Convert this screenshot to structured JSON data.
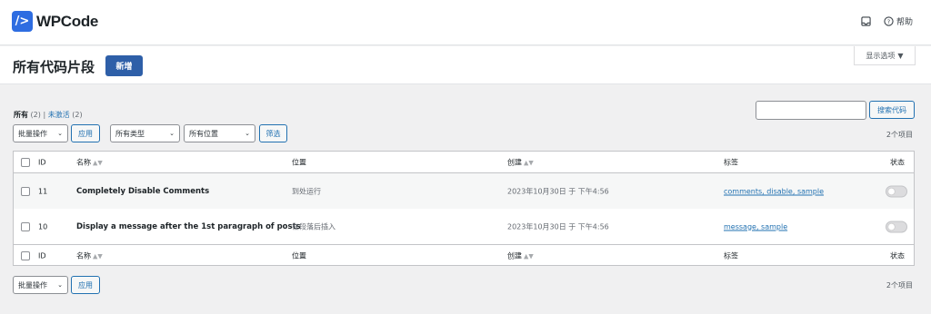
{
  "app": {
    "logo_glyph": "/>",
    "logo_text": "WPCode",
    "help_label": "帮助"
  },
  "header": {
    "title": "所有代码片段",
    "add_new": "新增",
    "screen_options": "显示选项"
  },
  "filters": {
    "all_label": "所有",
    "all_count": "(2)",
    "separator": "|",
    "inactive_label": "未激活",
    "inactive_count": "(2)"
  },
  "search": {
    "button": "搜索代码",
    "value": ""
  },
  "bulk": {
    "select_label": "批量操作",
    "apply": "应用"
  },
  "type_filter": {
    "selected": "所有类型"
  },
  "location_filter": {
    "selected": "所有位置"
  },
  "filter_button": "筛选",
  "items_count": "2个项目",
  "columns": {
    "id": "ID",
    "name": "名称",
    "location": "位置",
    "created": "创建",
    "tags": "标签",
    "status": "状态"
  },
  "rows": [
    {
      "id": "11",
      "name": "Completely Disable Comments",
      "location": "到处运行",
      "created": "2023年10月30日 于 下午4:56",
      "tags": "comments, disable, sample"
    },
    {
      "id": "10",
      "name": "Display a message after the 1st paragraph of posts",
      "location": "在段落后插入",
      "created": "2023年10月30日 于 下午4:56",
      "tags": "message, sample"
    }
  ],
  "colors": {
    "accent": "#2e5fa8",
    "link": "#2271b1"
  }
}
